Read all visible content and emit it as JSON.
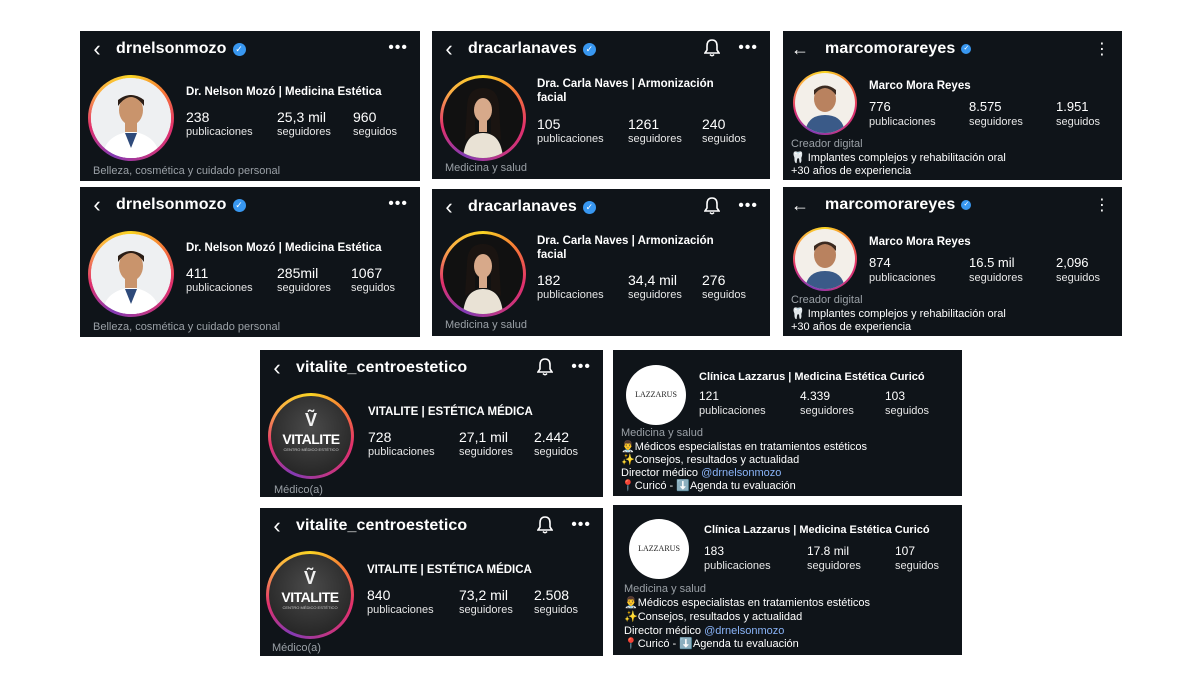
{
  "cards": {
    "nelson1": {
      "username": "drnelsonmozo",
      "fullname": "Dr. Nelson Mozó | Medicina Estética",
      "posts": "238",
      "followers": "25,3 mil",
      "following": "960",
      "category": "Belleza, cosmética y cuidado personal"
    },
    "nelson2": {
      "username": "drnelsonmozo",
      "fullname": "Dr. Nelson Mozó | Medicina Estética",
      "posts": "411",
      "followers": "285mil",
      "following": "1067",
      "category": "Belleza, cosmética y cuidado personal"
    },
    "carla1": {
      "username": "dracarlanaves",
      "fullname_1": "Dra. Carla Naves | Armonización",
      "fullname_2": "facial",
      "posts": "105",
      "followers": "1261",
      "following": "240",
      "category": "Medicina y salud"
    },
    "carla2": {
      "username": "dracarlanaves",
      "fullname_1": "Dra. Carla Naves | Armonización",
      "fullname_2": "facial",
      "posts": "182",
      "followers": "34,4 mil",
      "following": "276",
      "category": "Medicina y salud"
    },
    "marco1": {
      "username": "marcomorareyes",
      "fullname": "Marco Mora Reyes",
      "posts": "776",
      "followers": "8.575",
      "following": "1.951",
      "category": "Creador digital",
      "bio_1": "🦷 Implantes complejos y rehabilitación oral",
      "bio_2": "+30 años de experiencia"
    },
    "marco2": {
      "username": "marcomorareyes",
      "fullname": "Marco Mora Reyes",
      "posts": "874",
      "followers": "16.5 mil",
      "following": "2,096",
      "category": "Creador digital",
      "bio_1": "🦷 Implantes complejos y rehabilitación oral",
      "bio_2": "+30 años de experiencia"
    },
    "vital1": {
      "username": "vitalite_centroestetico",
      "fullname": "VITALITE | ESTÉTICA MÉDICA",
      "posts": "728",
      "followers": "27,1 mil",
      "following": "2.442",
      "category": "Médico(a)",
      "logo": "VITALITE",
      "logo_sub": "CENTRO MÉDICO ESTÉTICO"
    },
    "vital2": {
      "username": "vitalite_centroestetico",
      "fullname": "VITALITE | ESTÉTICA MÉDICA",
      "posts": "840",
      "followers": "73,2 mil",
      "following": "2.508",
      "category": "Médico(a)",
      "logo": "VITALITE",
      "logo_sub": "CENTRO MÉDICO ESTÉTICO"
    },
    "lazz1": {
      "fullname": "Clínica Lazzarus | Medicina Estética Curicó",
      "posts": "121",
      "followers": "4.339",
      "following": "103",
      "category": "Medicina y salud",
      "bio_1": "👨‍⚕️Médicos especialistas en tratamientos estéticos",
      "bio_2": "✨Consejos, resultados y actualidad",
      "bio_3a": "Director médico ",
      "bio_3b": "@drnelsonmozo",
      "bio_4": "📍Curicó - ⬇️Agenda tu evaluación",
      "logo": "LAZZARUS"
    },
    "lazz2": {
      "fullname": "Clínica Lazzarus | Medicina Estética Curicó",
      "posts": "183",
      "followers": "17.8 mil",
      "following": "107",
      "category": "Medicina y salud",
      "bio_1": "👨‍⚕️Médicos especialistas en tratamientos estéticos",
      "bio_2": "✨Consejos, resultados y actualidad",
      "bio_3a": "Director médico ",
      "bio_3b": "@drnelsonmozo",
      "bio_4": "📍Curicó - ⬇️Agenda tu evaluación",
      "logo": "LAZZARUS"
    }
  },
  "labels": {
    "posts": "publicaciones",
    "followers": "seguidores",
    "following": "seguidos"
  },
  "icons": {
    "back": "chevron-left-icon",
    "back_arrow": "arrow-left-icon",
    "more": "more-horizontal-icon",
    "more_v": "more-vertical-icon",
    "bell": "bell-icon",
    "verified": "verified-badge-icon"
  },
  "colors": {
    "background": "#0f1419",
    "verified": "#3897f0",
    "mention": "#8ab4f8",
    "category": "#9aa0a6"
  }
}
